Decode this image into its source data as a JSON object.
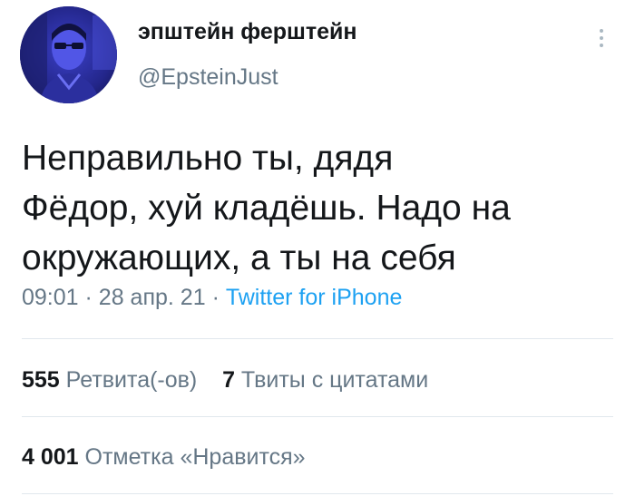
{
  "user": {
    "display_name": "эпштейн ферштейн",
    "handle": "@EpsteinJust",
    "avatar_icon": "avatar-image"
  },
  "menu": {
    "more_icon": "vertical-ellipsis-icon"
  },
  "tweet": {
    "lines": [
      "Неправильно ты, дядя",
      "Фёдор, хуй кладёшь. Надо на",
      "окружающих, а ты на себя"
    ],
    "time": "09:01",
    "separator": "·",
    "date": "28 апр. 21",
    "source": "Twitter for iPhone"
  },
  "stats": {
    "retweets_count": "555",
    "retweets_label": "Ретвита(-ов)",
    "quotes_count": "7",
    "quotes_label": "Твиты с цитатами",
    "likes_count": "4 001",
    "likes_label": "Отметка «Нравится»"
  },
  "colors": {
    "text": "#14171a",
    "secondary": "#657786",
    "link": "#1da1f2",
    "divider": "#e1e8ed"
  }
}
